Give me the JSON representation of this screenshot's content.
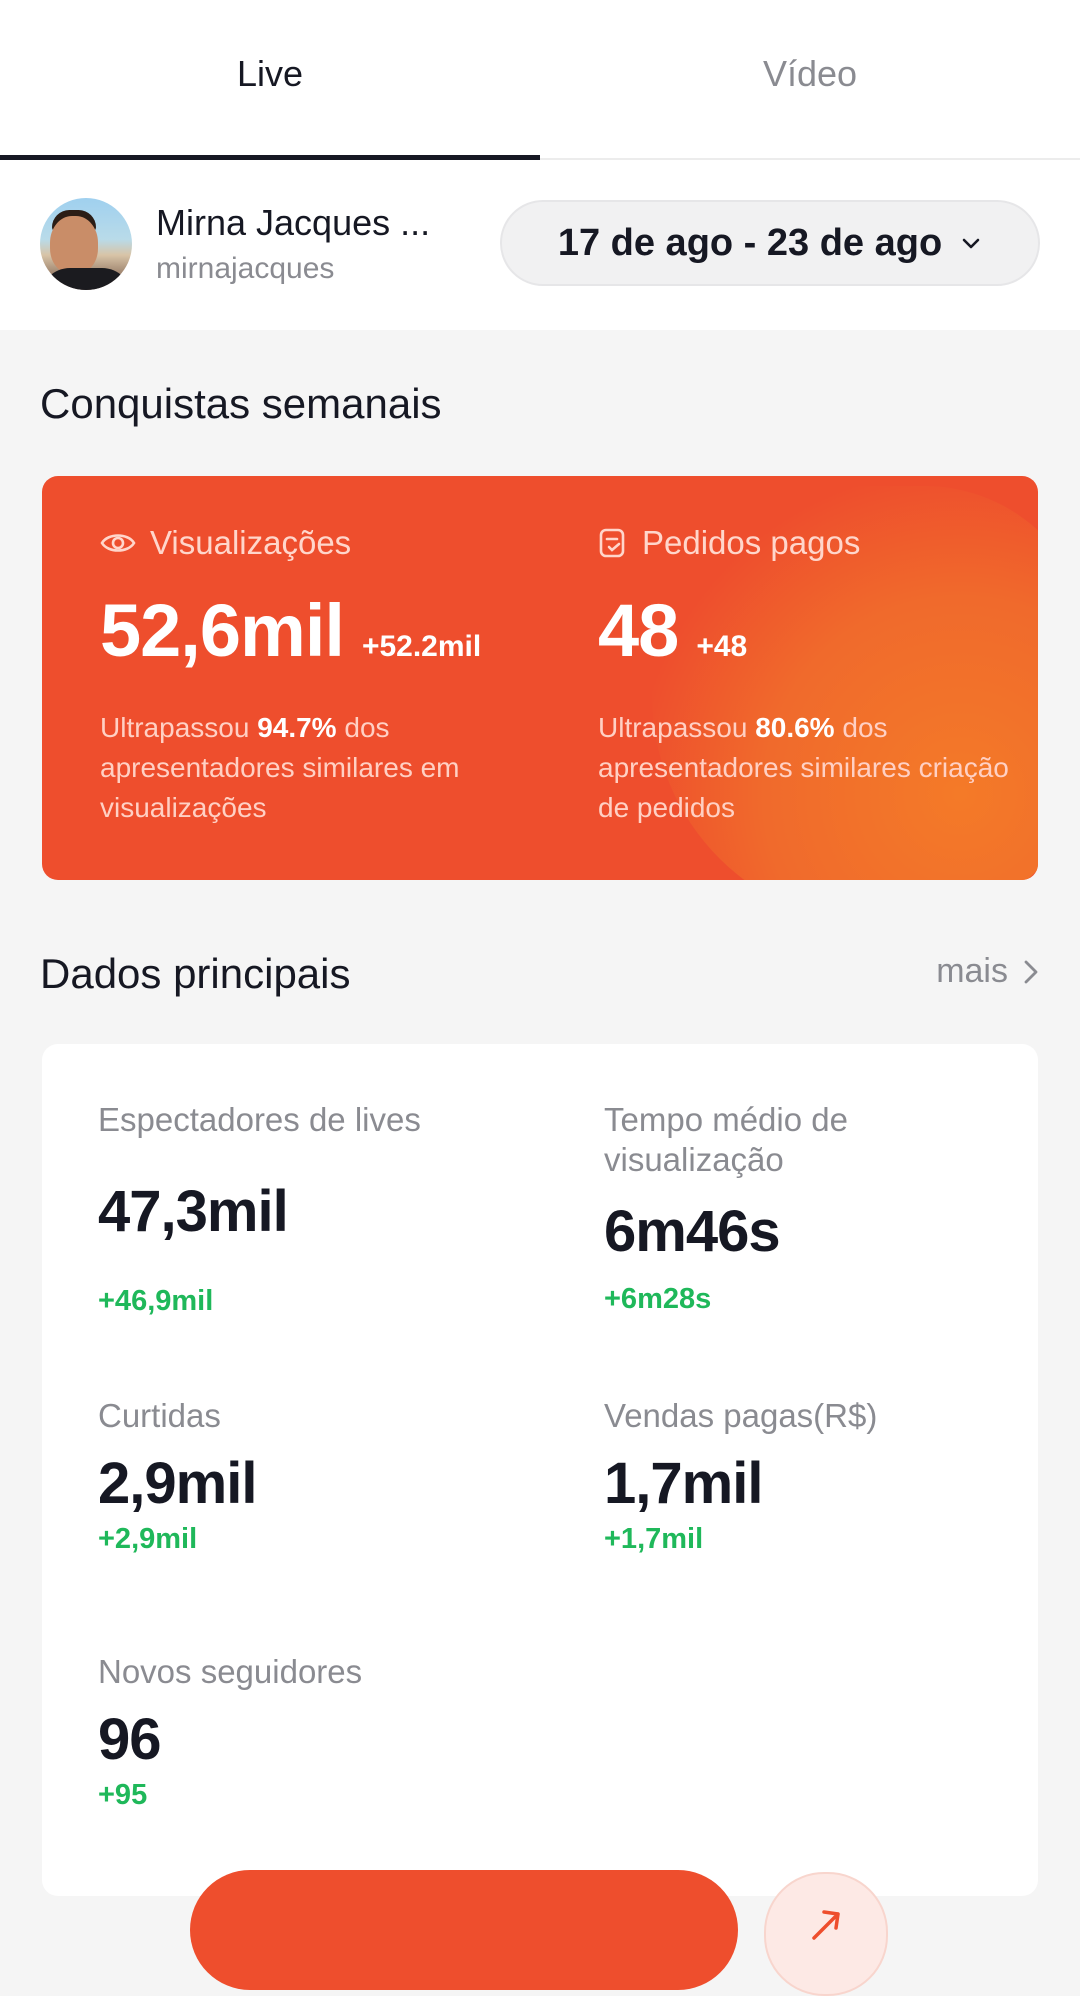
{
  "tabs": [
    {
      "label": "Live",
      "active": true
    },
    {
      "label": "Vídeo",
      "active": false
    }
  ],
  "profile": {
    "name": "Mirna Jacques ...",
    "handle": "mirnajacques",
    "date_range": "17 de ago - 23 de ago"
  },
  "achievements": {
    "title": "Conquistas semanais",
    "accent_color": "#ee4e2d",
    "items": [
      {
        "icon": "eye-icon",
        "label": "Visualizações",
        "value": "52,6mil",
        "delta": "+52.2mil",
        "desc_prefix": "Ultrapassou ",
        "desc_highlight": "94.7%",
        "desc_suffix": " dos apresentadores similares em visualizações"
      },
      {
        "icon": "order-icon",
        "label": "Pedidos pagos",
        "value": "48",
        "delta": "+48",
        "desc_prefix": "Ultrapassou ",
        "desc_highlight": "80.6%",
        "desc_suffix": " dos apresentadores similares criação de pedidos"
      }
    ]
  },
  "main_data": {
    "title": "Dados principais",
    "more_label": "mais",
    "positive_color": "#1fb85a",
    "metrics": [
      {
        "label": "Espectadores de lives",
        "value": "47,3mil",
        "delta": "+46,9mil"
      },
      {
        "label": "Tempo médio de visualização",
        "value": "6m46s",
        "delta": "+6m28s"
      },
      {
        "label": "Curtidas",
        "value": "2,9mil",
        "delta": "+2,9mil"
      },
      {
        "label": "Vendas pagas(R$)",
        "value": "1,7mil",
        "delta": "+1,7mil"
      },
      {
        "label": "Novos seguidores",
        "value": "96",
        "delta": "+95"
      }
    ]
  }
}
